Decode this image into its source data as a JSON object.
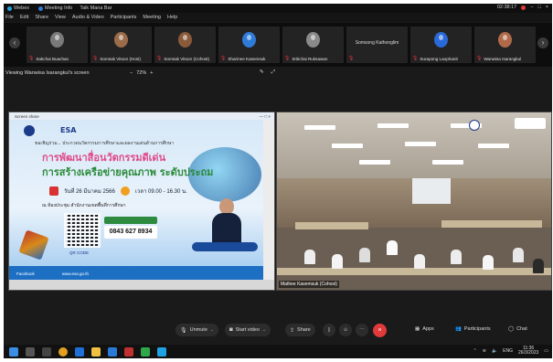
{
  "title_bar": {
    "items": [
      "Webex",
      "Meeting Info",
      "Talk Mana Bar"
    ],
    "timer": "02:38:17",
    "window_controls": [
      "−",
      "□",
      "×"
    ]
  },
  "menu": [
    "File",
    "Edit",
    "Share",
    "View",
    "Audio & Video",
    "Participants",
    "Meeting",
    "Help"
  ],
  "participants": [
    {
      "name": "Sakchai Buachan",
      "avatar_color": "#7a7a7a"
    },
    {
      "name": "Somsak Vitoon (Host)",
      "avatar_color": "#9b6b4a"
    },
    {
      "name": "Somsak Vitoon (Cohost)",
      "avatar_color": "#8a5a3a"
    },
    {
      "name": "Sharinee Kasemsuk",
      "avatar_color": "#2e7bd8"
    },
    {
      "name": "Sritichai Ruksawan",
      "avatar_color": "#8a8a8a"
    },
    {
      "name": "Somsong Kathonglim",
      "avatar_color": ""
    },
    {
      "name": "Surapong Laophanit",
      "avatar_color": "#2a6ad8"
    },
    {
      "name": "Wanwisa Isarangkul",
      "avatar_color": "#b06a4a"
    }
  ],
  "viewing": {
    "text": "Viewing Wanwisa Isarangkul's screen",
    "zoom_minus": "−",
    "zoom_level": "72%",
    "zoom_plus": "+"
  },
  "shared_window": {
    "title": "Screen share",
    "poster": {
      "org": "ESA",
      "intro": "ขอเชิญร่วม... ประกวดนวัตกรรมการศึกษาและผลงานเด่นด้านการศึกษา",
      "title_1": "การพัฒนาสื่อนวัตกรรมดีเด่น",
      "title_2": "การสร้างเครือข่ายคุณภาพ ระดับประถม",
      "date": "วันที่ 26 มีนาคม 2566",
      "time": "เวลา 09.00 - 16.30 น.",
      "venue": "ณ ห้องประชุม สำนักงานเขตพื้นที่การศึกษา",
      "phone": "0843 627 8934",
      "qr_label": "QR CODE",
      "footer_left": "Facebook",
      "footer_right": "www.esa.go.th"
    }
  },
  "camera": {
    "name": "Mathee Kasemsuk (Cohost)"
  },
  "controls": {
    "unmute": "Unmute",
    "start_video": "Start video",
    "share": "Share",
    "apps": "Apps",
    "participants": "Participants",
    "chat": "Chat",
    "leave": "×"
  },
  "taskbar": {
    "tray_lang": "ENG",
    "time": "11:36",
    "date": "26/3/2023"
  },
  "colors": {
    "leave_red": "#e03a3a",
    "webex_bg": "#1a1a1a"
  }
}
